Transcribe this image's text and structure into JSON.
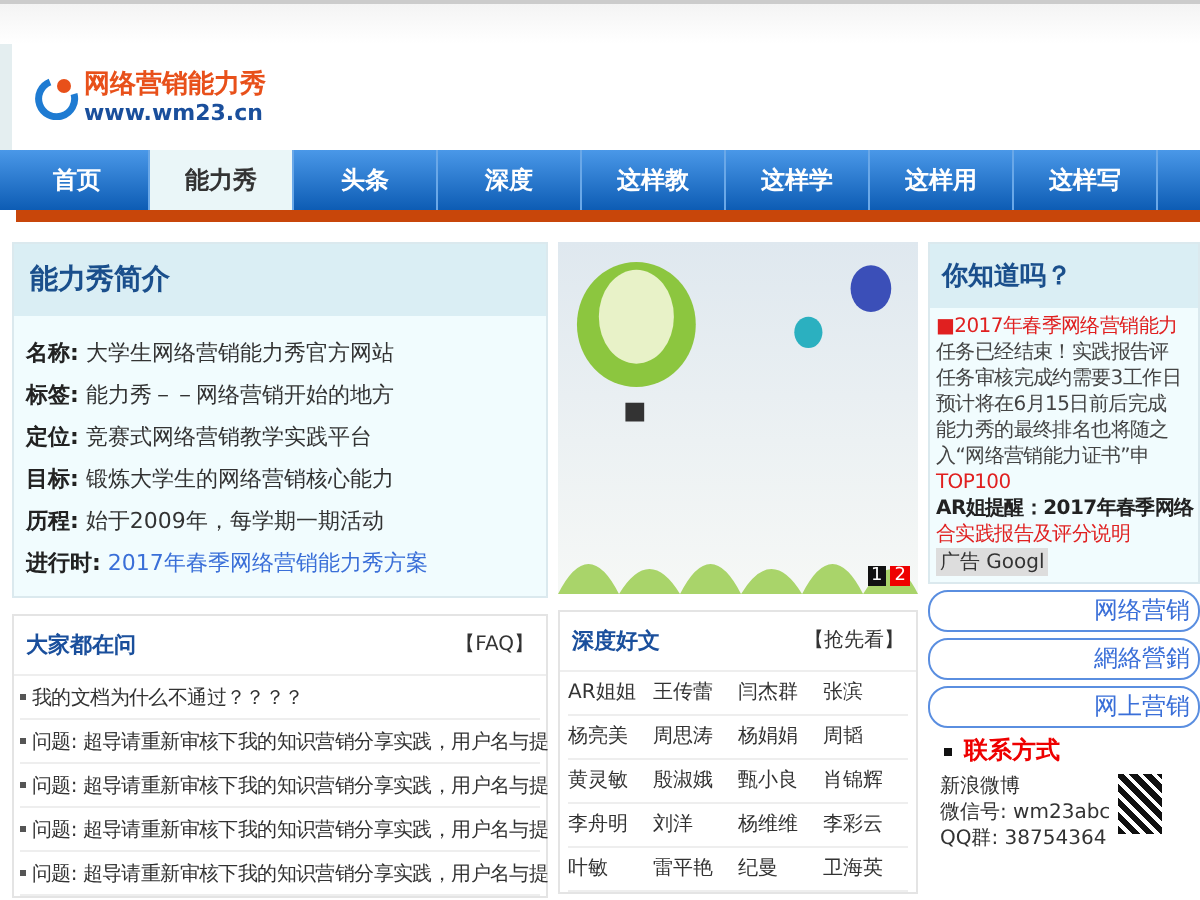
{
  "logo": {
    "title": "网络营销能力秀",
    "url": "www.wm23.cn"
  },
  "nav": [
    {
      "label": "首页",
      "selected": false
    },
    {
      "label": "能力秀",
      "selected": true
    },
    {
      "label": "头条",
      "selected": false
    },
    {
      "label": "深度",
      "selected": false
    },
    {
      "label": "这样教",
      "selected": false
    },
    {
      "label": "这样学",
      "selected": false
    },
    {
      "label": "这样用",
      "selected": false
    },
    {
      "label": "这样写",
      "selected": false
    }
  ],
  "intro": {
    "title": "能力秀简介",
    "items": [
      {
        "key": "名称:",
        "value": "大学生网络营销能力秀官方网站",
        "kind": "text"
      },
      {
        "key": "标签:",
        "value": "能力秀－－网络营销开始的地方",
        "kind": "text"
      },
      {
        "key": "定位:",
        "value": "竞赛式网络营销教学实践平台",
        "kind": "text"
      },
      {
        "key": "目标:",
        "value": "锻炼大学生的网络营销核心能力",
        "kind": "text"
      },
      {
        "key": "历程:",
        "value": "始于2009年，每学期一期活动",
        "kind": "text"
      },
      {
        "key": "进行时:",
        "value": "2017年春季网络营销能力秀方案",
        "kind": "link"
      }
    ]
  },
  "banner": {
    "pages": [
      {
        "label": "1",
        "selected": false
      },
      {
        "label": "2",
        "selected": true
      }
    ]
  },
  "faq": {
    "title": "大家都在问",
    "more": "【FAQ】",
    "items": [
      "我的文档为什么不通过？？？？",
      "问题: 超导请重新审核下我的知识营销分享实践，用户名与提",
      "问题: 超导请重新审核下我的知识营销分享实践，用户名与提",
      "问题: 超导请重新审核下我的知识营销分享实践，用户名与提",
      "问题: 超导请重新审核下我的知识营销分享实践，用户名与提"
    ]
  },
  "articles": {
    "title": "深度好文",
    "more": "【抢先看】",
    "names": [
      "AR姐姐",
      "王传蕾",
      "闫杰群",
      "张滨",
      "杨亮美",
      "周思涛",
      "杨娟娟",
      "周韬",
      "黄灵敏",
      "殷淑娥",
      "甄小良",
      "肖锦辉",
      "李舟明",
      "刘洋",
      "杨维维",
      "李彩云",
      "叶敏",
      "雷平艳",
      "纪曼",
      "卫海英"
    ]
  },
  "did_you_know": {
    "title": "你知道吗？",
    "lines": [
      {
        "text": "■2017年春季网络营销能力",
        "kind": "alert"
      },
      {
        "text": "任务已经结束！实践报告评",
        "kind": "plain"
      },
      {
        "text": "任务审核完成约需要3工作日",
        "kind": "plain"
      },
      {
        "text": "预计将在6月15日前后完成",
        "kind": "plain"
      },
      {
        "text": "能力秀的最终排名也将随之",
        "kind": "plain"
      },
      {
        "text": "入“网络营销能力证书”申",
        "kind": "plain"
      },
      {
        "text": "TOP100",
        "kind": "alert"
      },
      {
        "text": "AR姐提醒：2017年春季网络",
        "kind": "notice"
      },
      {
        "text": "合实践报告及评分说明",
        "kind": "alert"
      }
    ],
    "ad": "广告 Googl"
  },
  "buttons": [
    "网络营销",
    "網絡營銷",
    "网上营销"
  ],
  "contact": {
    "title": "联系方式",
    "lines": [
      "新浪微博",
      "微信号: wm23abc",
      "QQ群: 38754364"
    ]
  }
}
